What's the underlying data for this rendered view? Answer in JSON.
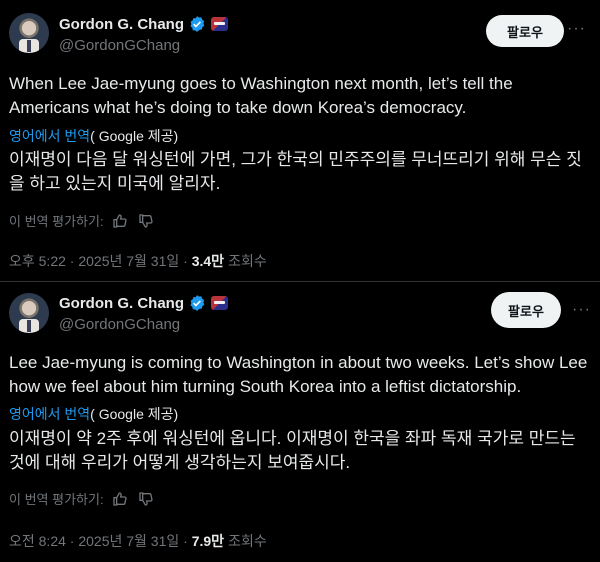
{
  "tweets": [
    {
      "author_name": "Gordon G. Chang",
      "handle": "@GordonGChang",
      "follow_label": "팔로우",
      "more_label": "···",
      "text_en": "When Lee Jae-myung goes to Washington next month, let’s tell the Americans what he’s doing to take down Korea’s democracy.",
      "translate_link": "영어에서 번역",
      "translate_by": "( Google 제공)",
      "text_ko": "이재명이 다음 달 워싱턴에 가면, 그가 한국의 민주주의를 무너뜨리기 위해 무슨 짓을 하고 있는지 미국에 알리자.",
      "rate_label": "이 번역 평가하기:",
      "timestamp": "오후 5:22 · 2025년 7월 31일 · ",
      "views_count": "3.4만",
      "views_label": "조회수"
    },
    {
      "author_name": "Gordon G. Chang",
      "handle": "@GordonGChang",
      "follow_label": "팔로우",
      "more_label": "···",
      "text_en": "Lee Jae-myung is coming to Washington in about two weeks. Let’s show Lee how we feel about him turning South Korea into a leftist dictatorship.",
      "translate_link": "영어에서 번역",
      "translate_by": "( Google 제공)",
      "text_ko": "이재명이 약 2주 후에 워싱턴에 옵니다. 이재명이 한국을 좌파 독재 국가로 만드는 것에 대해 우리가 어떻게 생각하는지 보여줍시다.",
      "rate_label": "이 번역 평가하기:",
      "timestamp": "오전 8:24 · 2025년 7월 31일 · ",
      "views_count": "7.9만",
      "views_label": "조회수"
    }
  ],
  "colors": {
    "background": "#000000",
    "text": "#e7e9ea",
    "secondary": "#71767b",
    "link": "#1d9bf0",
    "verified": "#1d9bf0",
    "follow_bg": "#eff3f4"
  },
  "icons": [
    "verified-badge-icon",
    "affiliation-badge-icon",
    "thumbs-up-icon",
    "thumbs-down-icon",
    "more-icon"
  ]
}
